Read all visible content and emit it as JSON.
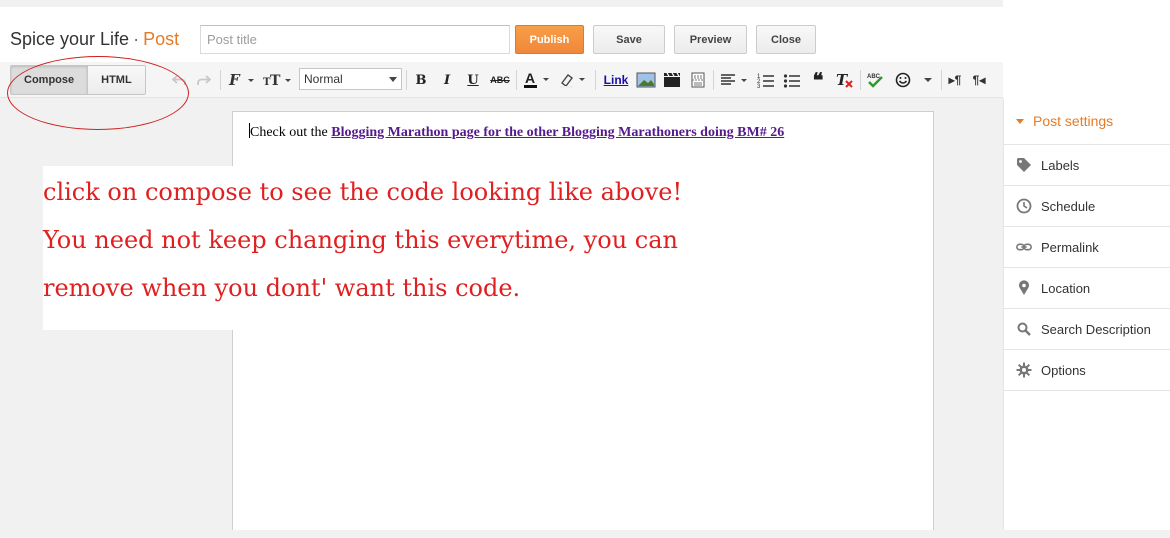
{
  "header": {
    "blog_name": "Spice your Life",
    "separator": "·",
    "section": "Post",
    "post_title_placeholder": "Post title",
    "buttons": {
      "publish": "Publish",
      "save": "Save",
      "preview": "Preview",
      "close": "Close"
    },
    "colors": {
      "accent": "#e67a25",
      "publish_bg": "#f0873a"
    }
  },
  "toolbar": {
    "modes": {
      "compose": "Compose",
      "html": "HTML",
      "active": "Compose"
    },
    "font_size_value": "Normal",
    "link_label": "Link",
    "icons": [
      "undo-icon",
      "redo-icon",
      "font-family-icon",
      "font-size-icon",
      "bold-icon",
      "italic-icon",
      "underline-icon",
      "strikethrough-icon",
      "text-color-icon",
      "highlight-icon",
      "link",
      "insert-image-icon",
      "insert-video-icon",
      "insert-jump-break-icon",
      "align-icon",
      "numbered-list-icon",
      "bulleted-list-icon",
      "quote-icon",
      "remove-formatting-icon",
      "spellcheck-icon",
      "emoji-icon",
      "more-icon",
      "ltr-icon",
      "rtl-icon"
    ]
  },
  "editor": {
    "text_prefix": "Check out the ",
    "link_text": "Blogging Marathon page for the other Blogging Marathoners doing BM# 26",
    "link_color": "#551a8b"
  },
  "annotation": {
    "lines": [
      "click on compose to see the code looking like above!",
      "You need not keep changing this everytime, you can",
      "remove when you dont' want this code."
    ],
    "color": "#e02020"
  },
  "sidebar": {
    "heading": "Post settings",
    "items": [
      {
        "label": "Labels",
        "icon": "label-tag-icon"
      },
      {
        "label": "Schedule",
        "icon": "clock-icon"
      },
      {
        "label": "Permalink",
        "icon": "link-chain-icon"
      },
      {
        "label": "Location",
        "icon": "map-pin-icon"
      },
      {
        "label": "Search Description",
        "icon": "search-icon"
      },
      {
        "label": "Options",
        "icon": "gear-icon"
      }
    ]
  }
}
